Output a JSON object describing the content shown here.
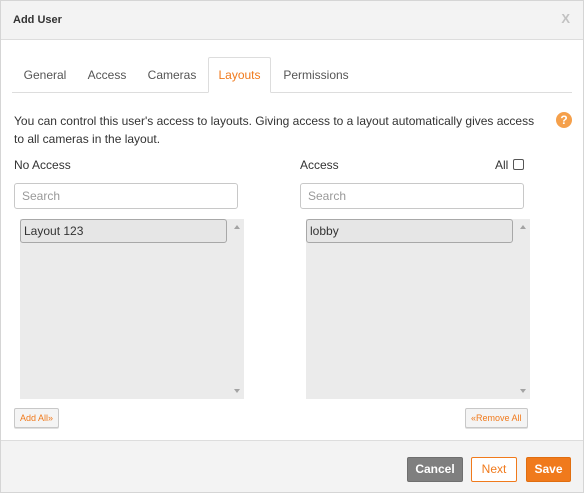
{
  "dialog": {
    "title": "Add User",
    "close_label": "X"
  },
  "tabs": [
    {
      "label": "General",
      "active": false
    },
    {
      "label": "Access",
      "active": false
    },
    {
      "label": "Cameras",
      "active": false
    },
    {
      "label": "Layouts",
      "active": true
    },
    {
      "label": "Permissions",
      "active": false
    }
  ],
  "description": "You can control this user's access to layouts. Giving access to a layout automatically gives access to all cameras in the layout.",
  "help_icon": {
    "icon": "question-circle-icon",
    "glyph": "?"
  },
  "no_access": {
    "label": "No Access",
    "search_placeholder": "Search",
    "items": [
      "Layout 123"
    ],
    "add_all_label": "Add All»"
  },
  "access": {
    "label": "Access",
    "all_label": "All",
    "all_checked": false,
    "search_placeholder": "Search",
    "items": [
      "lobby"
    ],
    "remove_all_label": "«Remove All"
  },
  "footer": {
    "cancel_label": "Cancel",
    "next_label": "Next",
    "save_label": "Save"
  },
  "colors": {
    "accent": "#f07a1c",
    "cancel_bg": "#7f7f7f",
    "header_bg": "#f3f3f3",
    "list_bg": "#ebebeb"
  }
}
